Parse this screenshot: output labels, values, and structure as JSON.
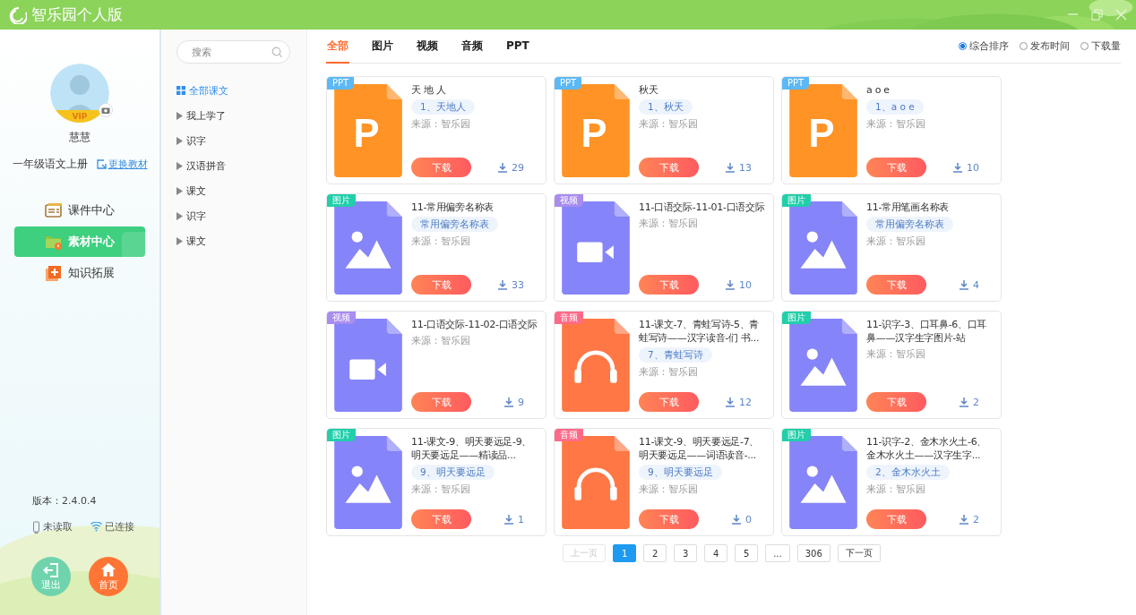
{
  "window": {
    "title": "智乐园个人版"
  },
  "profile": {
    "name": "慧慧",
    "badge": "VIP",
    "textbook": "一年级语文上册",
    "change_link": "更换教材"
  },
  "nav": [
    {
      "label": "课件中心",
      "kind": "courseware",
      "selected": false
    },
    {
      "label": "素材中心",
      "kind": "materials",
      "selected": true
    },
    {
      "label": "知识拓展",
      "kind": "extension",
      "selected": false
    }
  ],
  "footer": {
    "version": "版本：2.4.0.4",
    "status": [
      {
        "kind": "device",
        "label": "未读取"
      },
      {
        "kind": "wifi",
        "label": "已连接"
      }
    ],
    "buttons": [
      {
        "kind": "exit",
        "label": "退出"
      },
      {
        "kind": "home",
        "label": "首页"
      }
    ]
  },
  "tree": {
    "search": {
      "placeholder": "搜索"
    },
    "items": [
      {
        "kind": "all",
        "label": "全部课文",
        "selected": true
      },
      {
        "kind": "branch",
        "label": "我上学了",
        "selected": false,
        "expanded": false
      },
      {
        "kind": "branch",
        "label": "识字",
        "selected": false,
        "expanded": false
      },
      {
        "kind": "branch",
        "label": "汉语拼音",
        "selected": false,
        "expanded": false
      },
      {
        "kind": "branch",
        "label": "课文",
        "selected": false,
        "expanded": false
      },
      {
        "kind": "branch",
        "label": "识字",
        "selected": false,
        "expanded": false
      },
      {
        "kind": "branch",
        "label": "课文",
        "selected": false,
        "expanded": false
      }
    ]
  },
  "tabs": [
    {
      "label": "全部",
      "selected": true
    },
    {
      "label": "图片",
      "selected": false
    },
    {
      "label": "视频",
      "selected": false
    },
    {
      "label": "音频",
      "selected": false
    },
    {
      "label": "PPT",
      "selected": false
    }
  ],
  "sort": [
    {
      "label": "综合排序",
      "selected": true
    },
    {
      "label": "发布时间",
      "selected": false
    },
    {
      "label": "下载量",
      "selected": false
    }
  ],
  "cards": [
    {
      "kind": "ppt",
      "badge": "PPT",
      "icon_text": "P",
      "title": "天 地 人",
      "tag": "1、天地人",
      "source": "来源：智乐园",
      "button": "下载",
      "downloads": "29"
    },
    {
      "kind": "ppt",
      "badge": "PPT",
      "icon_text": "P",
      "title": "秋天",
      "tag": "1、秋天",
      "source": "来源：智乐园",
      "button": "下载",
      "downloads": "13"
    },
    {
      "kind": "ppt",
      "badge": "PPT",
      "icon_text": "P",
      "title": "a o e",
      "tag": "1、a o e",
      "source": "来源：智乐园",
      "button": "下载",
      "downloads": "10"
    },
    {
      "kind": "image",
      "badge": "图片",
      "title": "11-常用偏旁名称表",
      "tag": "常用偏旁名称表",
      "source": "来源：智乐园",
      "button": "下载",
      "downloads": "33"
    },
    {
      "kind": "video",
      "badge": "视频",
      "title": "11-口语交际-11-01-口语交际",
      "source": "来源：智乐园",
      "button": "下载",
      "downloads": "10"
    },
    {
      "kind": "image",
      "badge": "图片",
      "title": "11-常用笔画名称表",
      "tag": "常用偏旁名称表",
      "source": "来源：智乐园",
      "button": "下载",
      "downloads": "4"
    },
    {
      "kind": "video",
      "badge": "视频",
      "title": "11-口语交际-11-02-口语交际",
      "source": "来源：智乐园",
      "button": "下载",
      "downloads": "9"
    },
    {
      "kind": "audio",
      "badge": "音频",
      "title": "11-课文-7、青蛙写诗-5、青蛙写诗——汉字读音-们 书...",
      "tag": "7、青蛙写诗",
      "source": "来源：智乐园",
      "button": "下载",
      "downloads": "12"
    },
    {
      "kind": "image",
      "badge": "图片",
      "title": "11-识字-3、口耳鼻-6、口耳鼻——汉字生字图片-站",
      "source": "来源：智乐园",
      "button": "下载",
      "downloads": "2"
    },
    {
      "kind": "image",
      "badge": "图片",
      "title": "11-课文-9、明天要远足-9、明天要远足——精读品...",
      "tag": "9、明天要远足",
      "source": "来源：智乐园",
      "button": "下载",
      "downloads": "1"
    },
    {
      "kind": "audio",
      "badge": "音频",
      "title": "11-课文-9、明天要远足-7、明天要远足——词语读音-...",
      "tag": "9、明天要远足",
      "source": "来源：智乐园",
      "button": "下载",
      "downloads": "0"
    },
    {
      "kind": "image",
      "badge": "图片",
      "title": "11-识字-2、金木水火土-6、金木水火土——汉字生字...",
      "tag": "2、金木水火土",
      "source": "来源：智乐园",
      "button": "下载",
      "downloads": "2"
    }
  ],
  "pager": {
    "prev": {
      "label": "上一页",
      "disabled": true
    },
    "pages": [
      {
        "label": "1",
        "selected": true
      },
      {
        "label": "2",
        "selected": false
      },
      {
        "label": "3",
        "selected": false
      },
      {
        "label": "4",
        "selected": false
      },
      {
        "label": "5",
        "selected": false
      },
      {
        "label": "...",
        "selected": false
      },
      {
        "label": "306",
        "selected": false
      }
    ],
    "next": {
      "label": "下一页",
      "disabled": false
    }
  }
}
